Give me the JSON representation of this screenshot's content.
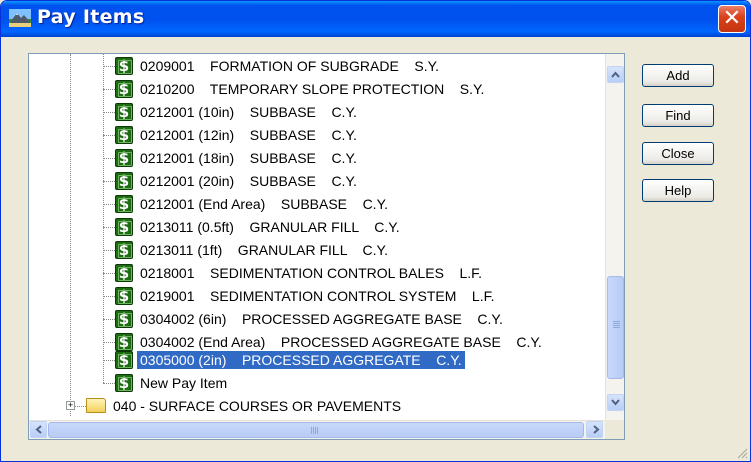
{
  "window": {
    "title": "Pay Items",
    "close_glyph": "✕",
    "title_icon": "pay-items-app-icon"
  },
  "tree": {
    "items": [
      {
        "label": "0209001    FORMATION OF SUBGRADE    S.Y.",
        "icon": "pay-item-dollar-icon",
        "selected": false
      },
      {
        "label": "0210200    TEMPORARY SLOPE PROTECTION    S.Y.",
        "icon": "pay-item-dollar-icon",
        "selected": false
      },
      {
        "label": "0212001 (10in)    SUBBASE    C.Y.",
        "icon": "pay-item-dollar-icon",
        "selected": false
      },
      {
        "label": "0212001 (12in)    SUBBASE    C.Y.",
        "icon": "pay-item-dollar-icon",
        "selected": false
      },
      {
        "label": "0212001 (18in)    SUBBASE    C.Y.",
        "icon": "pay-item-dollar-icon",
        "selected": false
      },
      {
        "label": "0212001 (20in)    SUBBASE    C.Y.",
        "icon": "pay-item-dollar-icon",
        "selected": false
      },
      {
        "label": "0212001 (End Area)    SUBBASE    C.Y.",
        "icon": "pay-item-dollar-icon",
        "selected": false
      },
      {
        "label": "0213011 (0.5ft)    GRANULAR FILL    C.Y.",
        "icon": "pay-item-dollar-icon",
        "selected": false
      },
      {
        "label": "0213011 (1ft)    GRANULAR FILL    C.Y.",
        "icon": "pay-item-dollar-icon",
        "selected": false
      },
      {
        "label": "0218001    SEDIMENTATION CONTROL BALES    L.F.",
        "icon": "pay-item-dollar-icon",
        "selected": false
      },
      {
        "label": "0219001    SEDIMENTATION CONTROL SYSTEM    L.F.",
        "icon": "pay-item-dollar-icon",
        "selected": false
      },
      {
        "label": "0304002 (6in)    PROCESSED AGGREGATE BASE    C.Y.",
        "icon": "pay-item-dollar-icon",
        "selected": false
      },
      {
        "label": "0304002 (End Area)    PROCESSED AGGREGATE BASE    C.Y.",
        "icon": "pay-item-dollar-icon",
        "selected": false
      },
      {
        "label": "0305000 (2in)    PROCESSED AGGREGATE    C.Y.",
        "icon": "pay-item-dollar-icon",
        "selected": true
      },
      {
        "label": "New Pay Item",
        "icon": "pay-item-dollar-icon",
        "selected": false
      }
    ],
    "folder": {
      "label": "040 - SURFACE COURSES OR PAVEMENTS",
      "expander": "+",
      "icon": "folder-icon"
    }
  },
  "buttons": {
    "add": "Add",
    "find": "Find",
    "close": "Close",
    "help": "Help"
  },
  "colors": {
    "selection": "#316AC5",
    "titlebar": "#0054E3",
    "dollar_icon": "#1E6B14",
    "close_button": "#D9431E"
  }
}
